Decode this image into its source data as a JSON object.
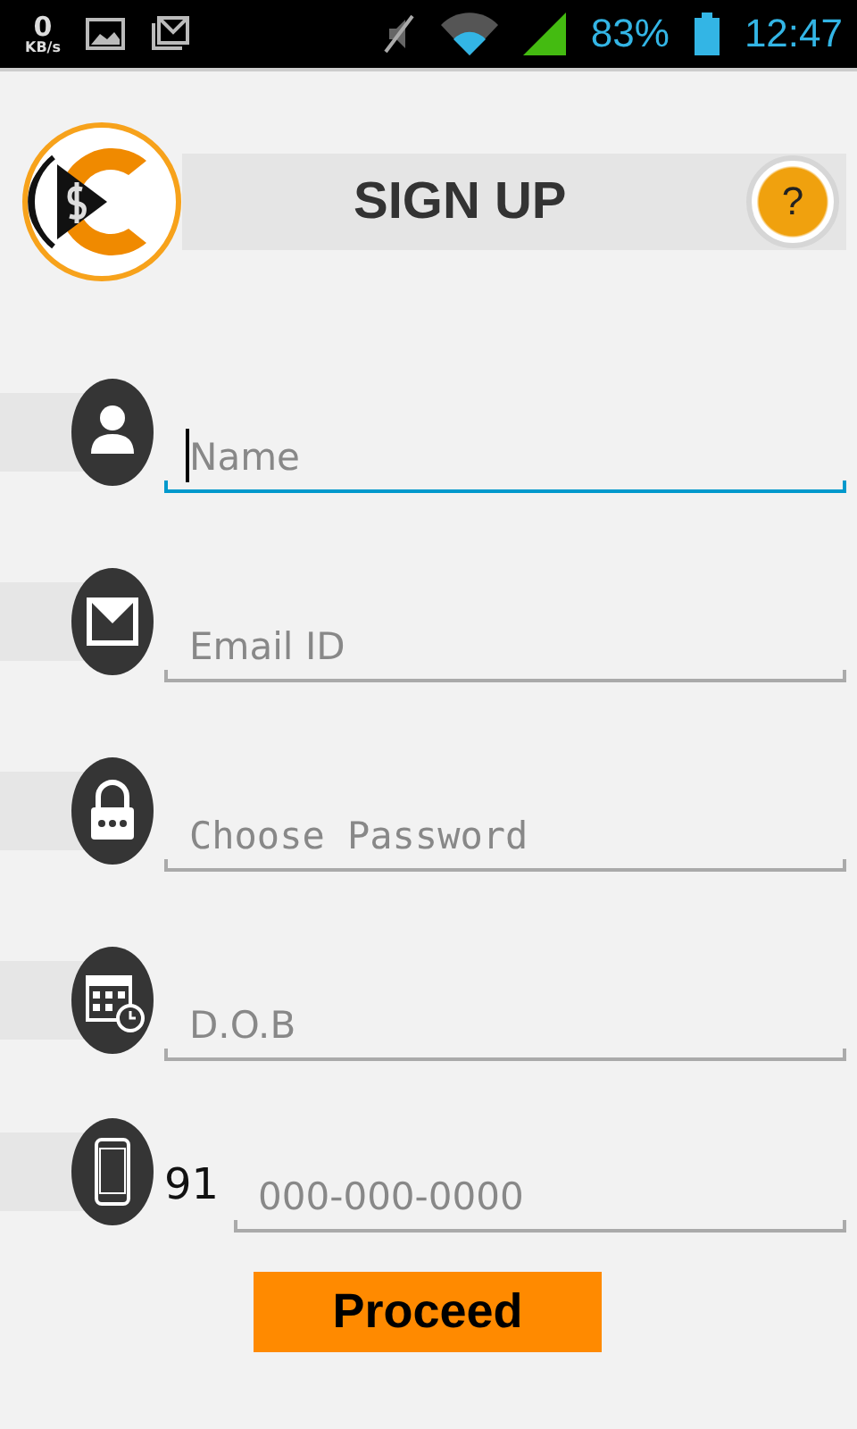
{
  "status_bar": {
    "speed_value": "0",
    "speed_unit": "KB/s",
    "battery": "83%",
    "time": "12:47"
  },
  "header": {
    "title": "SIGN UP",
    "help": "?"
  },
  "fields": [
    {
      "kind": "user",
      "placeholder": "Name",
      "focused": true
    },
    {
      "kind": "mail",
      "placeholder": "Email ID",
      "focused": false
    },
    {
      "kind": "lock",
      "placeholder": "Choose Password",
      "focused": false
    },
    {
      "kind": "calendar",
      "placeholder": "D.O.B",
      "focused": false
    },
    {
      "kind": "phone",
      "prefix": "91",
      "placeholder": "000-000-0000",
      "focused": false
    }
  ],
  "button": "Proceed"
}
